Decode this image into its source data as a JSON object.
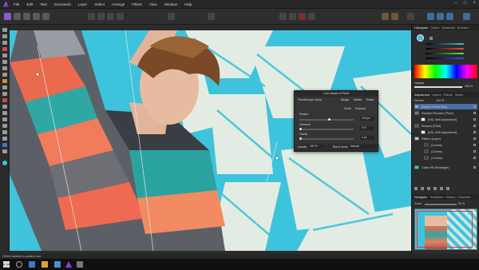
{
  "menubar": {
    "items": [
      "File",
      "Edit",
      "Text",
      "Document",
      "Layer",
      "Select",
      "Arrange",
      "Filters",
      "View",
      "Window",
      "Help"
    ]
  },
  "status": {
    "text": "DRAG handles to position blur."
  },
  "dof_dialog": {
    "title": "Live Depth of Field",
    "tabs": [
      "Passthrough"
    ],
    "merge_label": "Merge",
    "delete_label": "Delete",
    "reset_label": "Reset",
    "mode_label": "Mode",
    "mode_value": "Elliptical",
    "radius_label": "Radius",
    "radius_value": "15.6 px",
    "vibrance_label": "Vibrance",
    "vibrance_value": "0 %",
    "clarity_label": "Clarity",
    "clarity_value": "0 px",
    "opacity_label": "Opacity",
    "opacity_value": "100 %",
    "blend_label": "Blend Mode",
    "blend_value": "Normal",
    "tab_label": "Passthrough Alpha"
  },
  "right_panel": {
    "top_tabs": [
      "Histogram",
      "Colour",
      "Swatches",
      "Brushes"
    ],
    "opacity_label": "Opacity",
    "opacity_value": "100 %",
    "layer_tabs": [
      "Adjustment",
      "Layers",
      "Effects",
      "Styles"
    ],
    "blend_label": "Normal",
    "layer_opacity": "100 %",
    "layers": [
      {
        "name": "[Depth of Field Blur]"
      },
      {
        "name": "Sweater Recolour (Pixel)"
      },
      {
        "name": "[HSL Shift Adjustment]"
      },
      {
        "name": "Shadow (Pixel)"
      },
      {
        "name": "[HSL Shift Adjustment]"
      },
      {
        "name": "Pattern (Layer)"
      },
      {
        "name": "(Curves)"
      },
      {
        "name": "(Curves)"
      },
      {
        "name": "(Curves)"
      },
      {
        "name": "Colour fill (Rectangle)"
      }
    ],
    "nav_tabs": [
      "Navigator",
      "Transform",
      "History",
      "Channels"
    ],
    "zoom_label": "Zoom",
    "zoom_value": "54 %"
  },
  "accent": "#3ec3dd",
  "brand": "#a64dff"
}
